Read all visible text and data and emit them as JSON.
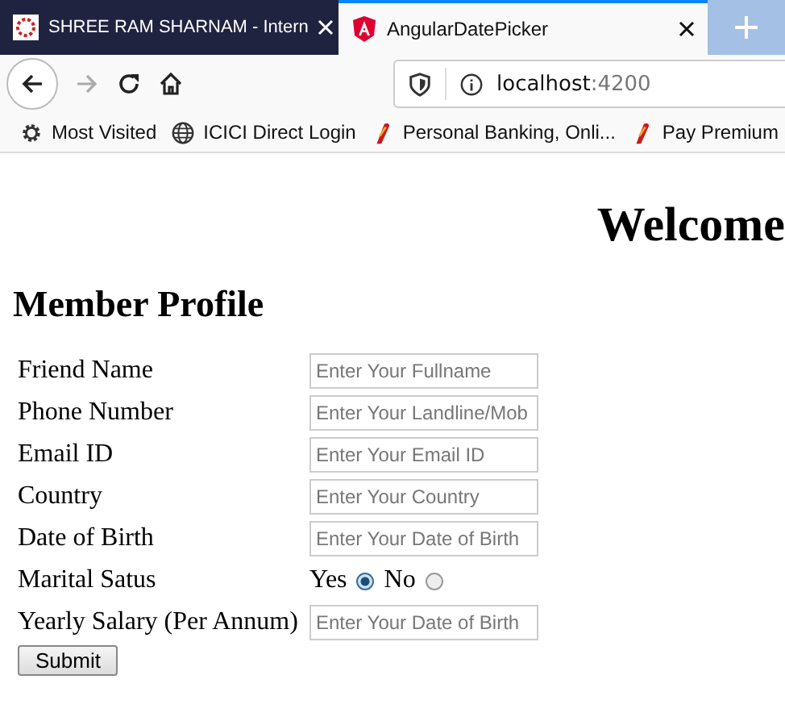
{
  "tabs": [
    {
      "title": "SHREE RAM SHARNAM - Intern",
      "selected": false,
      "kind": "site"
    },
    {
      "title": "AngularDatePicker",
      "selected": true,
      "kind": "angular"
    }
  ],
  "address": {
    "host": "localhost",
    "port": ":4200"
  },
  "bookmarks": [
    {
      "label": "Most Visited",
      "kind": "gear"
    },
    {
      "label": "ICICI Direct Login",
      "kind": "globe"
    },
    {
      "label": "Personal Banking, Onli...",
      "kind": "bank"
    },
    {
      "label": "Pay Premium",
      "kind": "bank"
    }
  ],
  "heading": "Welcome",
  "form": {
    "title": "Member Profile",
    "fields": [
      {
        "label": "Friend Name",
        "kind": "text",
        "placeholder": "Enter Your Fullname"
      },
      {
        "label": "Phone Number",
        "kind": "text",
        "placeholder": "Enter Your Landline/Mob"
      },
      {
        "label": "Email ID",
        "kind": "text",
        "placeholder": "Enter Your Email ID"
      },
      {
        "label": "Country",
        "kind": "text",
        "placeholder": "Enter Your Country"
      },
      {
        "label": "Date of Birth",
        "kind": "text",
        "placeholder": "Enter Your Date of Birth"
      },
      {
        "label": "Marital Satus",
        "kind": "radio",
        "options": [
          {
            "label": "Yes",
            "selected": true
          },
          {
            "label": "No",
            "selected": false
          }
        ]
      },
      {
        "label": "Yearly Salary (Per Annum)",
        "kind": "text",
        "placeholder": "Enter Your Date of Birth"
      }
    ],
    "submit": "Submit"
  }
}
